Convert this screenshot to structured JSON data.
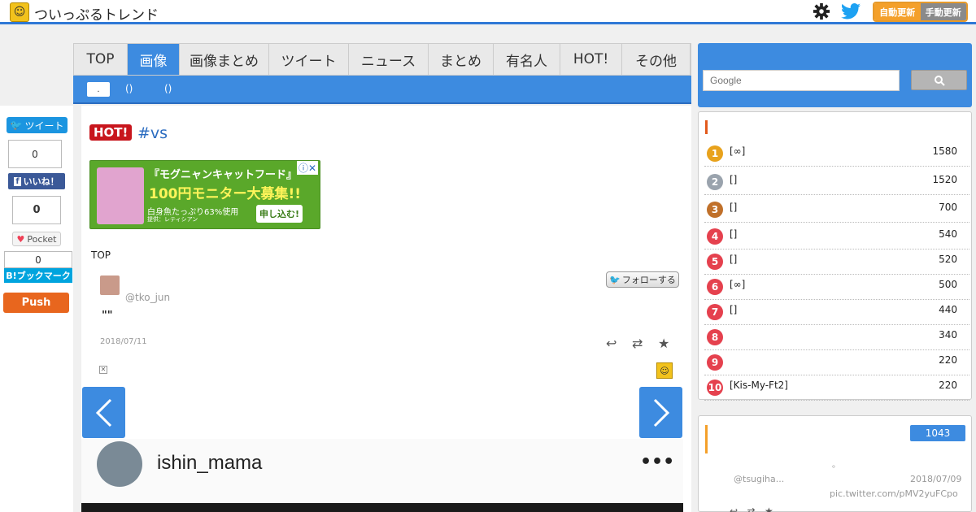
{
  "header": {
    "site_title": "ついっぷるトレンド",
    "auto_update": "自動更新",
    "manual_update": "手動更新"
  },
  "nav": {
    "tabs": [
      {
        "label": "TOP",
        "width": 66
      },
      {
        "label": "画像",
        "width": 64,
        "active": true
      },
      {
        "label": "画像まとめ",
        "width": 110
      },
      {
        "label": "ツイート",
        "width": 98
      },
      {
        "label": "ニュース",
        "width": 98
      },
      {
        "label": "まとめ",
        "width": 80
      },
      {
        "label": "有名人",
        "width": 82
      },
      {
        "label": "HOT!",
        "width": 76
      },
      {
        "label": "その他",
        "width": 84
      }
    ],
    "sub": {
      "pill": ".",
      "p1": "()",
      "p2": "()"
    }
  },
  "share": {
    "tweet": "ツイート",
    "tw_count": "0",
    "fb_like": "いいね！",
    "pocket_count": "0",
    "pocket": "Pocket",
    "hatena_count": "0",
    "hatena": "B!ブックマーク",
    "push": "Push"
  },
  "article": {
    "hot_badge": "HOT!",
    "title": "#vs",
    "breadcrumb": "TOP",
    "handle": "@tko_jun",
    "follow": "フォローする",
    "quote": "\"\"",
    "date": "2018/07/11",
    "ig_username": "ishin_mama",
    "ig_menu": "•••"
  },
  "ad": {
    "line1": "『モグニャンキャットフード』",
    "line2": "100円モニター大募集!!",
    "line3": "白身魚たっぷり63%使用",
    "line4": "提供：レティシアン",
    "apply": "申し込む!"
  },
  "search": {
    "placeholder": "Google"
  },
  "ranking": {
    "items": [
      {
        "rank": "1",
        "name": "[∞]",
        "count": "1580",
        "color": "#e8a21c"
      },
      {
        "rank": "2",
        "name": "[]",
        "count": "1520",
        "color": "#9aa3ad"
      },
      {
        "rank": "3",
        "name": "[]",
        "count": "700",
        "color": "#c0702a"
      },
      {
        "rank": "4",
        "name": "[]",
        "count": "540",
        "color": "#e5414e"
      },
      {
        "rank": "5",
        "name": "[]",
        "count": "520",
        "color": "#e5414e"
      },
      {
        "rank": "6",
        "name": "[∞]",
        "count": "500",
        "color": "#e5414e"
      },
      {
        "rank": "7",
        "name": "[]",
        "count": "440",
        "color": "#e5414e"
      },
      {
        "rank": "8",
        "name": "",
        "count": "340",
        "color": "#e5414e"
      },
      {
        "rank": "9",
        "name": "",
        "count": "220",
        "color": "#e5414e"
      },
      {
        "rank": "10",
        "name": "[Kis-My-Ft2]",
        "count": "220",
        "color": "#e5414e"
      }
    ]
  },
  "box2": {
    "count": "1043",
    "dot": "。",
    "handle": "@tsugiha...",
    "date": "2018/07/09",
    "pic_link": "pic.twitter.com/pMV2yuFCpo"
  },
  "colors": {
    "accent": "#3d8be0",
    "hot": "#c8161d",
    "push": "#e8661e"
  }
}
